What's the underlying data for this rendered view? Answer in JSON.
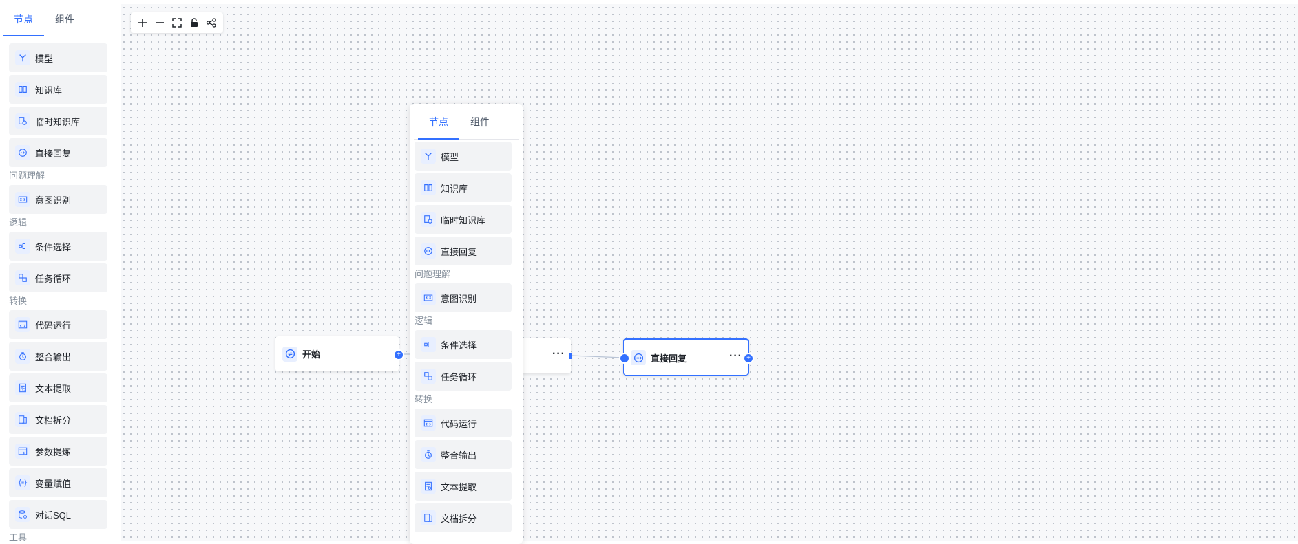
{
  "sidebar": {
    "tabs": [
      {
        "label": "节点"
      },
      {
        "label": "组件"
      }
    ],
    "items": [
      {
        "label": "模型",
        "icon": "model-icon"
      },
      {
        "label": "知识库",
        "icon": "book-icon"
      },
      {
        "label": "临时知识库",
        "icon": "temp-kb-icon"
      },
      {
        "label": "直接回复",
        "icon": "reply-icon"
      },
      {
        "label": "意图识别",
        "icon": "intent-icon"
      },
      {
        "label": "条件选择",
        "icon": "branch-icon"
      },
      {
        "label": "任务循环",
        "icon": "loop-icon"
      },
      {
        "label": "代码运行",
        "icon": "code-icon"
      },
      {
        "label": "整合输出",
        "icon": "merge-icon"
      },
      {
        "label": "文本提取",
        "icon": "text-extract-icon"
      },
      {
        "label": "文档拆分",
        "icon": "doc-split-icon"
      },
      {
        "label": "参数提炼",
        "icon": "param-icon"
      },
      {
        "label": "变量赋值",
        "icon": "variable-icon"
      },
      {
        "label": "对话SQL",
        "icon": "database-icon"
      }
    ],
    "groups": [
      "问题理解",
      "逻辑",
      "转换",
      "工具"
    ]
  },
  "panel": {
    "tabs": [
      {
        "label": "节点"
      },
      {
        "label": "组件"
      }
    ],
    "items": [
      {
        "label": "模型"
      },
      {
        "label": "知识库"
      },
      {
        "label": "临时知识库"
      },
      {
        "label": "直接回复"
      },
      {
        "label": "意图识别"
      },
      {
        "label": "条件选择"
      },
      {
        "label": "任务循环"
      },
      {
        "label": "代码运行"
      },
      {
        "label": "整合输出"
      },
      {
        "label": "文本提取"
      },
      {
        "label": "文档拆分"
      }
    ],
    "groups": [
      "问题理解",
      "逻辑",
      "转换"
    ]
  },
  "nodes": {
    "start": {
      "title": "开始"
    },
    "reply": {
      "title": "直接回复"
    },
    "more": "···"
  },
  "toolbar": {
    "buttons": [
      "zoom-in-icon",
      "zoom-out-icon",
      "fullscreen-icon",
      "lock-icon",
      "layout-icon"
    ]
  },
  "colors": {
    "accent": "#3370ff",
    "item_bg": "#f2f3f5",
    "icon_bg": "#e8efff"
  }
}
